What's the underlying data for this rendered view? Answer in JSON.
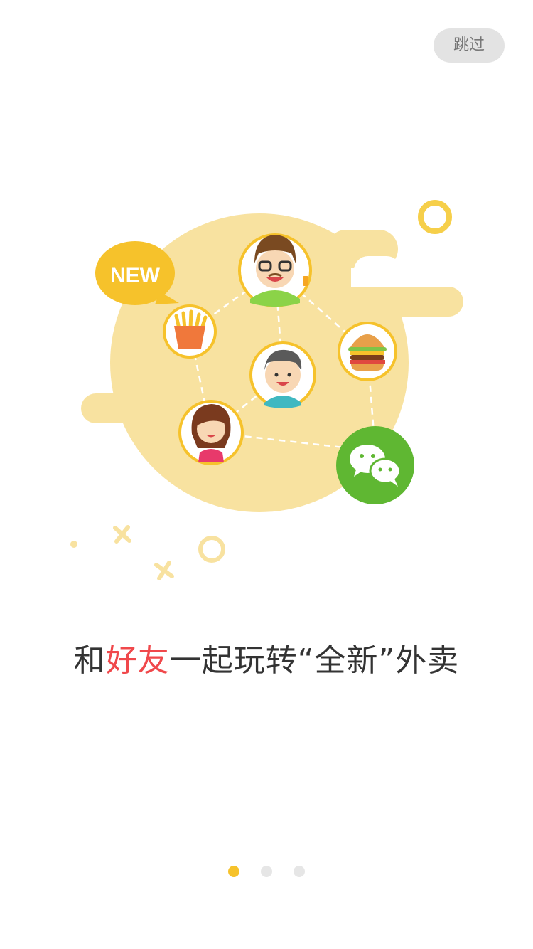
{
  "header": {
    "skip_label": "跳过"
  },
  "illustration": {
    "badge_text": "NEW",
    "items": [
      "friend-avatar-glasses",
      "french-fries-icon",
      "burger-icon",
      "friend-avatar-boy",
      "friend-avatar-girl",
      "wechat-icon"
    ]
  },
  "tagline": {
    "prefix": "和",
    "highlight": "好友",
    "suffix": "一起玩转“全新”外卖"
  },
  "pager": {
    "total": 3,
    "active_index": 0
  },
  "colors": {
    "accent_yellow": "#f6c22b",
    "blob_yellow": "#f8e2a0",
    "highlight_red": "#f0484b",
    "wechat_green": "#5fb732"
  }
}
